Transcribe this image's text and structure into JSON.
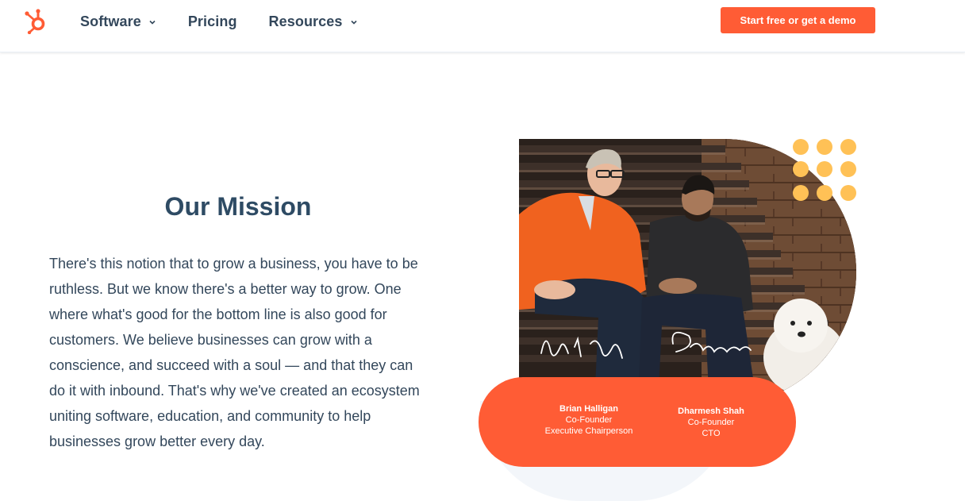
{
  "header": {
    "logo": "hubspot-logo",
    "nav": [
      {
        "label": "Software",
        "has_dropdown": true
      },
      {
        "label": "Pricing",
        "has_dropdown": false
      },
      {
        "label": "Resources",
        "has_dropdown": true
      }
    ],
    "cta_label": "Start free or get a demo"
  },
  "mission": {
    "title": "Our Mission",
    "body": "There's this notion that to grow a business, you have to be ruthless. But we know there's a better way to grow. One where what's good for the bottom line is also good for customers. We believe businesses can grow with a conscience, and succeed with a soul — and that they can do it with inbound. That's why we've created an ecosystem uniting software, education, and community to help businesses grow better every day."
  },
  "founders": [
    {
      "name": "Brian Halligan",
      "role1": "Co-Founder",
      "role2": "Executive Chairperson"
    },
    {
      "name": "Dharmesh Shah",
      "role1": "Co-Founder",
      "role2": "CTO"
    }
  ],
  "colors": {
    "brand_orange": "#ff5c35",
    "heading_navy": "#2e4b64",
    "text": "#33475b",
    "dot_yellow": "#ffc156"
  }
}
